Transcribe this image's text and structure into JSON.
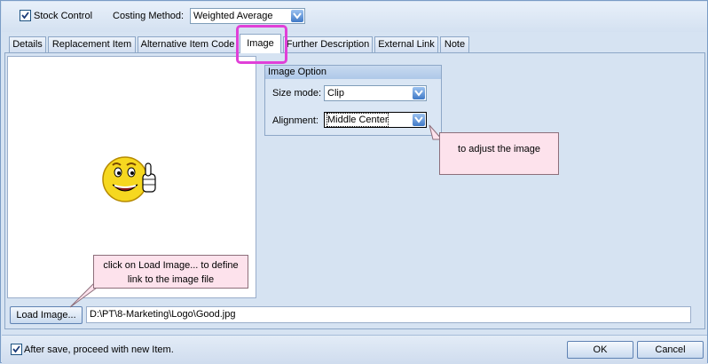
{
  "top": {
    "stock_control_label": "Stock Control",
    "stock_control_checked": true,
    "costing_method_label": "Costing Method:",
    "costing_method_value": "Weighted Average"
  },
  "tabs": [
    {
      "label": "Details"
    },
    {
      "label": "Replacement Item"
    },
    {
      "label": "Alternative Item Code"
    },
    {
      "label": "Image",
      "active": true
    },
    {
      "label": "Further Description"
    },
    {
      "label": "External Link"
    },
    {
      "label": "Note"
    }
  ],
  "image_option": {
    "title": "Image Option",
    "size_mode_label": "Size mode:",
    "size_mode_value": "Clip",
    "alignment_label": "Alignment:",
    "alignment_value": "Middle Center"
  },
  "callouts": {
    "adjust": "to adjust the image",
    "load": "click on Load Image... to define link to the image file"
  },
  "load_button": "Load Image...",
  "file_path": "D:\\PT\\8-Marketing\\Logo\\Good.jpg",
  "footer": {
    "after_save_label": "After save, proceed with new Item.",
    "after_save_checked": true,
    "ok_label": "OK",
    "cancel_label": "Cancel"
  },
  "colors": {
    "highlight": "#e040d8",
    "callout_fill": "#fde2ec",
    "dropdown_button": "#3f79c6"
  },
  "icons": [
    "checkmark-icon",
    "chevron-down-icon",
    "smiley-thumbs-up-icon"
  ]
}
